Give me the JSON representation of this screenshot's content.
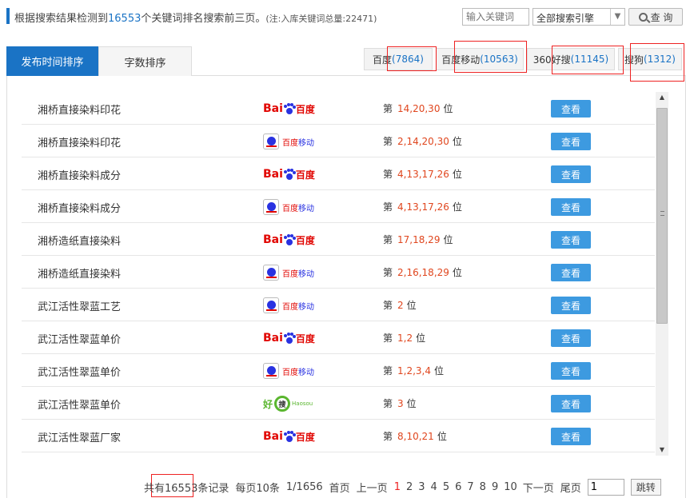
{
  "header": {
    "summary_prefix": "根据搜索结果检测到",
    "total_count": "16553",
    "summary_suffix": "个关键词排名搜索前三页。",
    "note": "(注:入库关键词总量:22471)",
    "keyword_placeholder": "输入关键词",
    "engine_select": "全部搜索引擎",
    "search_label": "查 询"
  },
  "sort_tabs": [
    {
      "label": "发布时间排序",
      "active": true
    },
    {
      "label": "字数排序",
      "active": false
    }
  ],
  "engine_tabs": [
    {
      "name": "百度",
      "count": "(7864)"
    },
    {
      "name": "百度移动",
      "count": "(10563)"
    },
    {
      "name": "360好搜",
      "count": "(11145)"
    },
    {
      "name": "搜狗",
      "count": "(1312)"
    }
  ],
  "rank_prefix": "第",
  "rank_suffix": "位",
  "view_label": "查看",
  "logos": {
    "baidu": {
      "bai": "Bai",
      "du": "百度"
    },
    "baidu_mobile": {
      "a": "百度",
      "b": "移动"
    },
    "haosou": {
      "a": "好",
      "b": "搜",
      "c": "Haosou"
    }
  },
  "rows": [
    {
      "keyword": "湘桥直接染料印花",
      "engine": "baidu",
      "positions": "14,20,30"
    },
    {
      "keyword": "湘桥直接染料印花",
      "engine": "baidu_mobile",
      "positions": "2,14,20,30"
    },
    {
      "keyword": "湘桥直接染料成分",
      "engine": "baidu",
      "positions": "4,13,17,26"
    },
    {
      "keyword": "湘桥直接染料成分",
      "engine": "baidu_mobile",
      "positions": "4,13,17,26"
    },
    {
      "keyword": "湘桥造纸直接染料",
      "engine": "baidu",
      "positions": "17,18,29"
    },
    {
      "keyword": "湘桥造纸直接染料",
      "engine": "baidu_mobile",
      "positions": "2,16,18,29"
    },
    {
      "keyword": "武江活性翠蓝工艺",
      "engine": "baidu_mobile",
      "positions": "2"
    },
    {
      "keyword": "武江活性翠蓝单价",
      "engine": "baidu",
      "positions": "1,2"
    },
    {
      "keyword": "武江活性翠蓝单价",
      "engine": "baidu_mobile",
      "positions": "1,2,3,4"
    },
    {
      "keyword": "武江活性翠蓝单价",
      "engine": "haosou",
      "positions": "3"
    },
    {
      "keyword": "武江活性翠蓝厂家",
      "engine": "baidu",
      "positions": "8,10,21"
    }
  ],
  "pager": {
    "total": "共有16553条记录",
    "per_page": "每页10条",
    "page_info": "1/1656",
    "first": "首页",
    "prev": "上一页",
    "pages": [
      "1",
      "2",
      "3",
      "4",
      "5",
      "6",
      "7",
      "8",
      "9",
      "10"
    ],
    "current": "1",
    "next": "下一页",
    "last": "尾页",
    "jump_value": "1",
    "jump_label": "跳转"
  },
  "colors": {
    "accent": "#1a73c5",
    "button": "#3d9ae0",
    "rank": "#e0461e",
    "highlight": "#e22222"
  }
}
